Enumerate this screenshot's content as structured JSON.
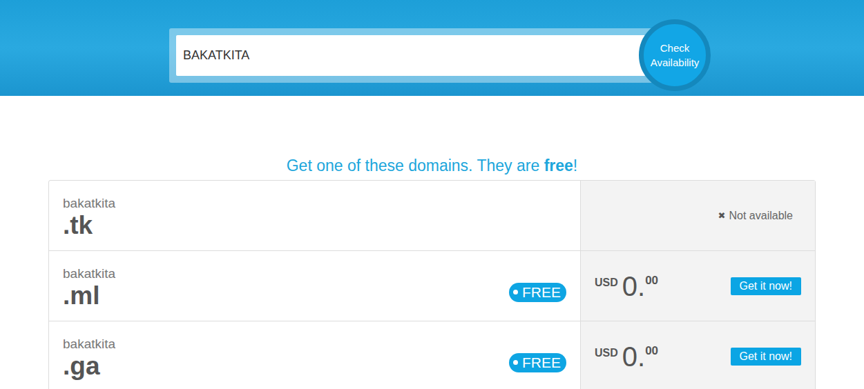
{
  "search": {
    "value": "BAKATKITA",
    "button": "Check Availability"
  },
  "heading": {
    "before": "Get one of these domains. They are ",
    "emphasis": "free",
    "after": "!"
  },
  "domains": [
    {
      "name": "bakatkita",
      "tld": ".tk",
      "available": false,
      "status_icon": "✖",
      "status": "Not available"
    },
    {
      "name": "bakatkita",
      "tld": ".ml",
      "available": true,
      "badge": "FREE",
      "currency": "USD",
      "price_whole": "0.",
      "price_cents": "00",
      "button": "Get it now!"
    },
    {
      "name": "bakatkita",
      "tld": ".ga",
      "available": true,
      "badge": "FREE",
      "currency": "USD",
      "price_whole": "0.",
      "price_cents": "00",
      "button": "Get it now!"
    }
  ]
}
